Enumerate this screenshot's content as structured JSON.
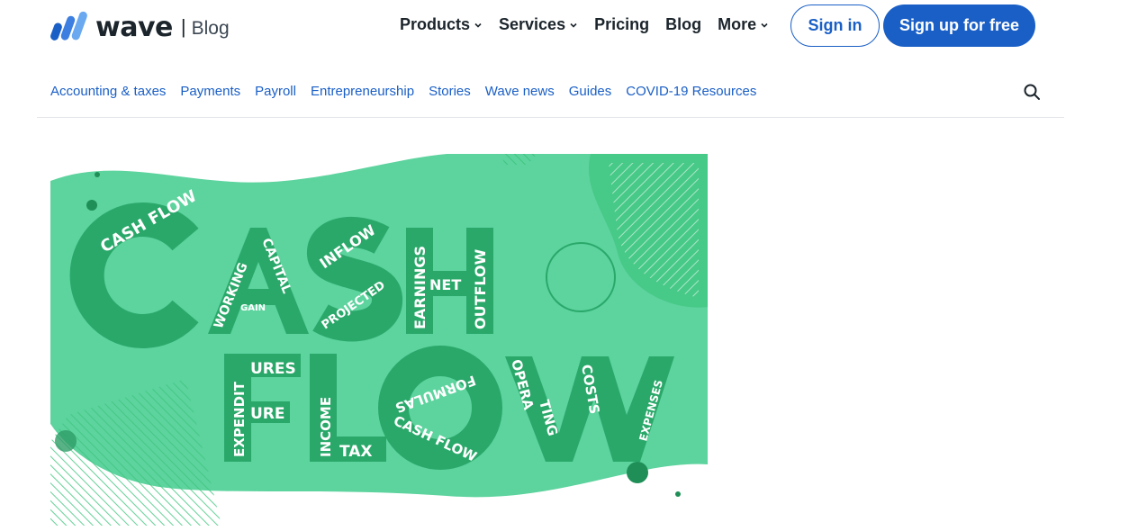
{
  "brand": {
    "name": "wave",
    "separator": "|",
    "section": "Blog"
  },
  "nav": {
    "items": [
      {
        "label": "Products",
        "dropdown": true
      },
      {
        "label": "Services",
        "dropdown": true
      },
      {
        "label": "Pricing",
        "dropdown": false
      },
      {
        "label": "Blog",
        "dropdown": false
      },
      {
        "label": "More",
        "dropdown": true
      }
    ],
    "signin": "Sign in",
    "signup": "Sign up for free"
  },
  "categories": [
    "Accounting & taxes",
    "Payments",
    "Payroll",
    "Entrepreneurship",
    "Stories",
    "Wave news",
    "Guides",
    "COVID-19 Resources"
  ],
  "hero": {
    "big_words": [
      "CASH",
      "FLOW"
    ],
    "words": {
      "cash_flow_circle": "CASH FLOW",
      "working": "WORKING",
      "capital": "CAPITAL",
      "gain": "GAIN",
      "inflow": "INFLOW",
      "projected": "PROJECTED",
      "earnings": "EARNINGS",
      "net": "NET",
      "outflow": "OUTFLOW",
      "expenditures_a": "EXPENDIT",
      "expenditures_b": "URES",
      "expenditures_c": "URE",
      "income": "INCOME",
      "tax": "TAX",
      "formulas": "FORMULAS",
      "cash_flow_o": "CASH FLOW",
      "opera": "OPERA",
      "ting": "TING",
      "costs": "COSTS",
      "expenses": "EXPENSES"
    },
    "colors": {
      "background": "#5dd39e",
      "dark": "#2aa86a",
      "accent": "#3fc57e"
    }
  },
  "icons": {
    "search": "search-icon",
    "chevron": "chevron-down-icon",
    "logo": "wave-logo-icon"
  },
  "colors": {
    "brand_blue": "#1a5fc6",
    "text": "#1c252c",
    "divider": "#e3e6ea"
  }
}
